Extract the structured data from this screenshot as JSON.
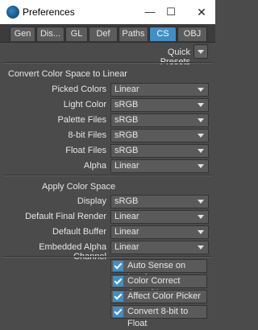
{
  "window": {
    "title": "Preferences",
    "minimize": "—",
    "maximize": "☐",
    "close": "✕"
  },
  "tabs": [
    "Gen",
    "Dis...",
    "GL",
    "Def",
    "Paths",
    "CS",
    "OBJ"
  ],
  "active_tab": "CS",
  "quick_presets": "Quick Presets",
  "section1": {
    "title": "Convert Color Space to Linear",
    "rows": [
      {
        "label": "Picked Colors",
        "value": "Linear"
      },
      {
        "label": "Light Color",
        "value": "sRGB"
      },
      {
        "label": "Palette Files",
        "value": "sRGB"
      },
      {
        "label": "8-bit Files",
        "value": "sRGB"
      },
      {
        "label": "Float Files",
        "value": "sRGB"
      },
      {
        "label": "Alpha",
        "value": "Linear"
      }
    ]
  },
  "section2": {
    "title": "Apply Color Space",
    "rows": [
      {
        "label": "Display",
        "value": "sRGB"
      },
      {
        "label": "Default Final Render",
        "value": "Linear"
      },
      {
        "label": "Default Buffer",
        "value": "Linear"
      },
      {
        "label": "Embedded Alpha Channel",
        "value": "Linear"
      }
    ]
  },
  "checks": [
    {
      "label": "Auto Sense on Load",
      "checked": true
    },
    {
      "label": "Color Correct OpenGL",
      "checked": true
    },
    {
      "label": "Affect Color Picker",
      "checked": true
    },
    {
      "label": "Convert 8-bit to Float",
      "checked": true
    }
  ],
  "colors": {
    "accent": "#3f8fc5",
    "panel": "#4b4b4b",
    "field": "#5a5a5a"
  }
}
